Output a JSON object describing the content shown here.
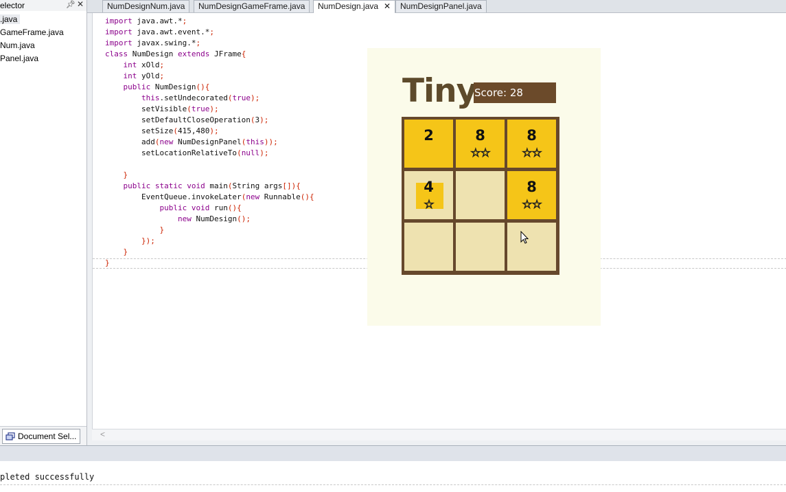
{
  "left_panel": {
    "title": "elector",
    "pin_icon": "pin-icon",
    "files": [
      ".java",
      "GameFrame.java",
      "Num.java",
      "Panel.java"
    ],
    "bottom_tab": "Document Sel..."
  },
  "tabs": [
    {
      "label": "NumDesignNum.java"
    },
    {
      "label": "NumDesignGameFrame.java"
    },
    {
      "label": "NumDesign.java",
      "close": "✕"
    },
    {
      "label": "NumDesignPanel.java"
    }
  ],
  "code_lines": [
    "import java.awt.*;",
    "import java.awt.event.*;",
    "import javax.swing.*;",
    "class NumDesign extends JFrame{",
    "    int xOld;",
    "    int yOld;",
    "    public NumDesign(){",
    "        this.setUndecorated(true);",
    "        setVisible(true);",
    "        setDefaultCloseOperation(3);",
    "        setSize(415,480);",
    "        add(new NumDesignPanel(this));",
    "        setLocationRelativeTo(null);",
    "",
    "    }",
    "    public static void main(String args[]){",
    "        EventQueue.invokeLater(new Runnable(){",
    "            public void run(){",
    "                new NumDesign();",
    "            }",
    "        });",
    "    }",
    "}"
  ],
  "output": {
    "text": "pleted successfully"
  },
  "game": {
    "title": "Tiny",
    "score_label": "Score: 28",
    "grid": [
      [
        {
          "value": "2",
          "stars": ""
        },
        {
          "value": "8",
          "stars": "☆☆"
        },
        {
          "value": "8",
          "stars": "☆☆"
        }
      ],
      [
        {
          "value": "4",
          "stars": "☆"
        },
        {
          "value": "",
          "stars": ""
        },
        {
          "value": "8",
          "stars": "☆☆"
        }
      ],
      [
        {
          "value": "",
          "stars": ""
        },
        {
          "value": "",
          "stars": ""
        },
        {
          "value": "",
          "stars": ""
        }
      ]
    ],
    "colors": {
      "background": "#fbfbea",
      "board_border": "#66482c",
      "tile_filled": "#f5c518",
      "tile_empty": "#eee2b0",
      "score_bg": "#6b4a2a",
      "title": "#5d4a2b"
    }
  }
}
